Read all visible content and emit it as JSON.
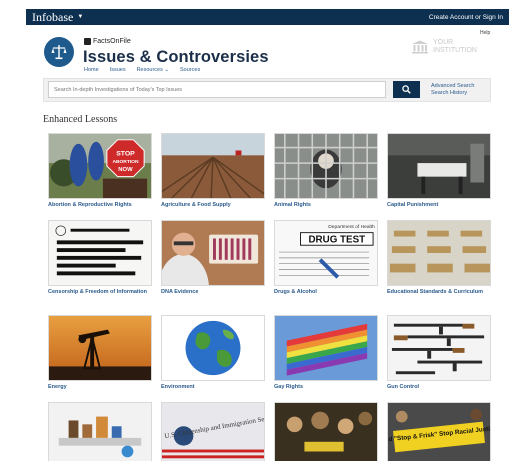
{
  "topbar": {
    "brand": "Infobase",
    "account": "Create Account or Sign In"
  },
  "help": "Help",
  "header": {
    "publisher": "FactsOnFile",
    "title": "Issues & Controversies",
    "nav": [
      "Home",
      "Issues",
      "Resources ⌄",
      "Sources"
    ],
    "institution": [
      "YOUR",
      "INSTITUTION"
    ]
  },
  "search": {
    "placeholder": "Search In-depth Investigations of Today's Top Issues",
    "advanced": "Advanced Search",
    "history": "Search History"
  },
  "section_title": "Enhanced Lessons",
  "tiles": [
    {
      "label": "Abortion & Reproductive Rights",
      "sign_text": "STOP ABORTION NOW"
    },
    {
      "label": "Agriculture & Food Supply"
    },
    {
      "label": "Animal Rights"
    },
    {
      "label": "Capital Punishment"
    },
    {
      "label": "Censorship & Freedom of Information"
    },
    {
      "label": "DNA Evidence"
    },
    {
      "label": "Drugs & Alcohol",
      "sign_text": "DRUG TEST",
      "sign_header": "Department of Health"
    },
    {
      "label": "Educational Standards & Curriculum"
    },
    {
      "label": "Energy"
    },
    {
      "label": "Environment"
    },
    {
      "label": "Gay Rights"
    },
    {
      "label": "Gun Control"
    },
    {
      "label": ""
    },
    {
      "label": "",
      "sign_text": "U.S. Citizenship and Immigration Services"
    },
    {
      "label": ""
    },
    {
      "label": "",
      "sign_text": "End \"Stop & Frisk\" Stop Racial Justice"
    }
  ],
  "colors": {
    "navy": "#0d3050",
    "link": "#2a5a8c",
    "title": "#1b2f4a"
  }
}
